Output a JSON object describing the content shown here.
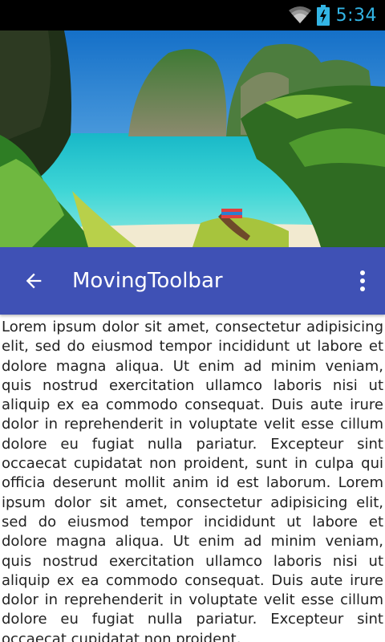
{
  "status_bar": {
    "time": "5:34",
    "icons": [
      "wifi-icon",
      "battery-charging-icon"
    ],
    "accent_color": "#33b5e5"
  },
  "hero": {
    "image": "tropical-beach-cliffs-longtail-boat"
  },
  "toolbar": {
    "title": "MovingToolbar",
    "background_color": "#3f51b5",
    "nav_icon": "arrow-back-icon",
    "menu_icon": "overflow-menu-icon"
  },
  "content": {
    "text": "Lorem ipsum dolor sit amet, consectetur adipisicing elit, sed do eiusmod tempor incididunt ut labore et dolore magna aliqua. Ut enim ad minim veniam, quis nostrud exercitation ullamco laboris nisi ut aliquip ex ea commodo consequat. Duis aute irure dolor in reprehenderit in voluptate velit esse cillum dolore eu fugiat nulla pariatur. Excepteur sint occaecat cupidatat non proident, sunt in culpa qui officia deserunt mollit anim id est laborum. Lorem ipsum dolor sit amet, consectetur adipisicing elit, sed do eiusmod tempor incididunt ut labore et dolore magna aliqua. Ut enim ad minim veniam, quis nostrud exercitation ullamco laboris nisi ut aliquip ex ea commodo consequat. Duis aute irure dolor in reprehenderit in voluptate velit esse cillum dolore eu fugiat nulla pariatur. Excepteur sint occaecat cupidatat non proident,"
  }
}
